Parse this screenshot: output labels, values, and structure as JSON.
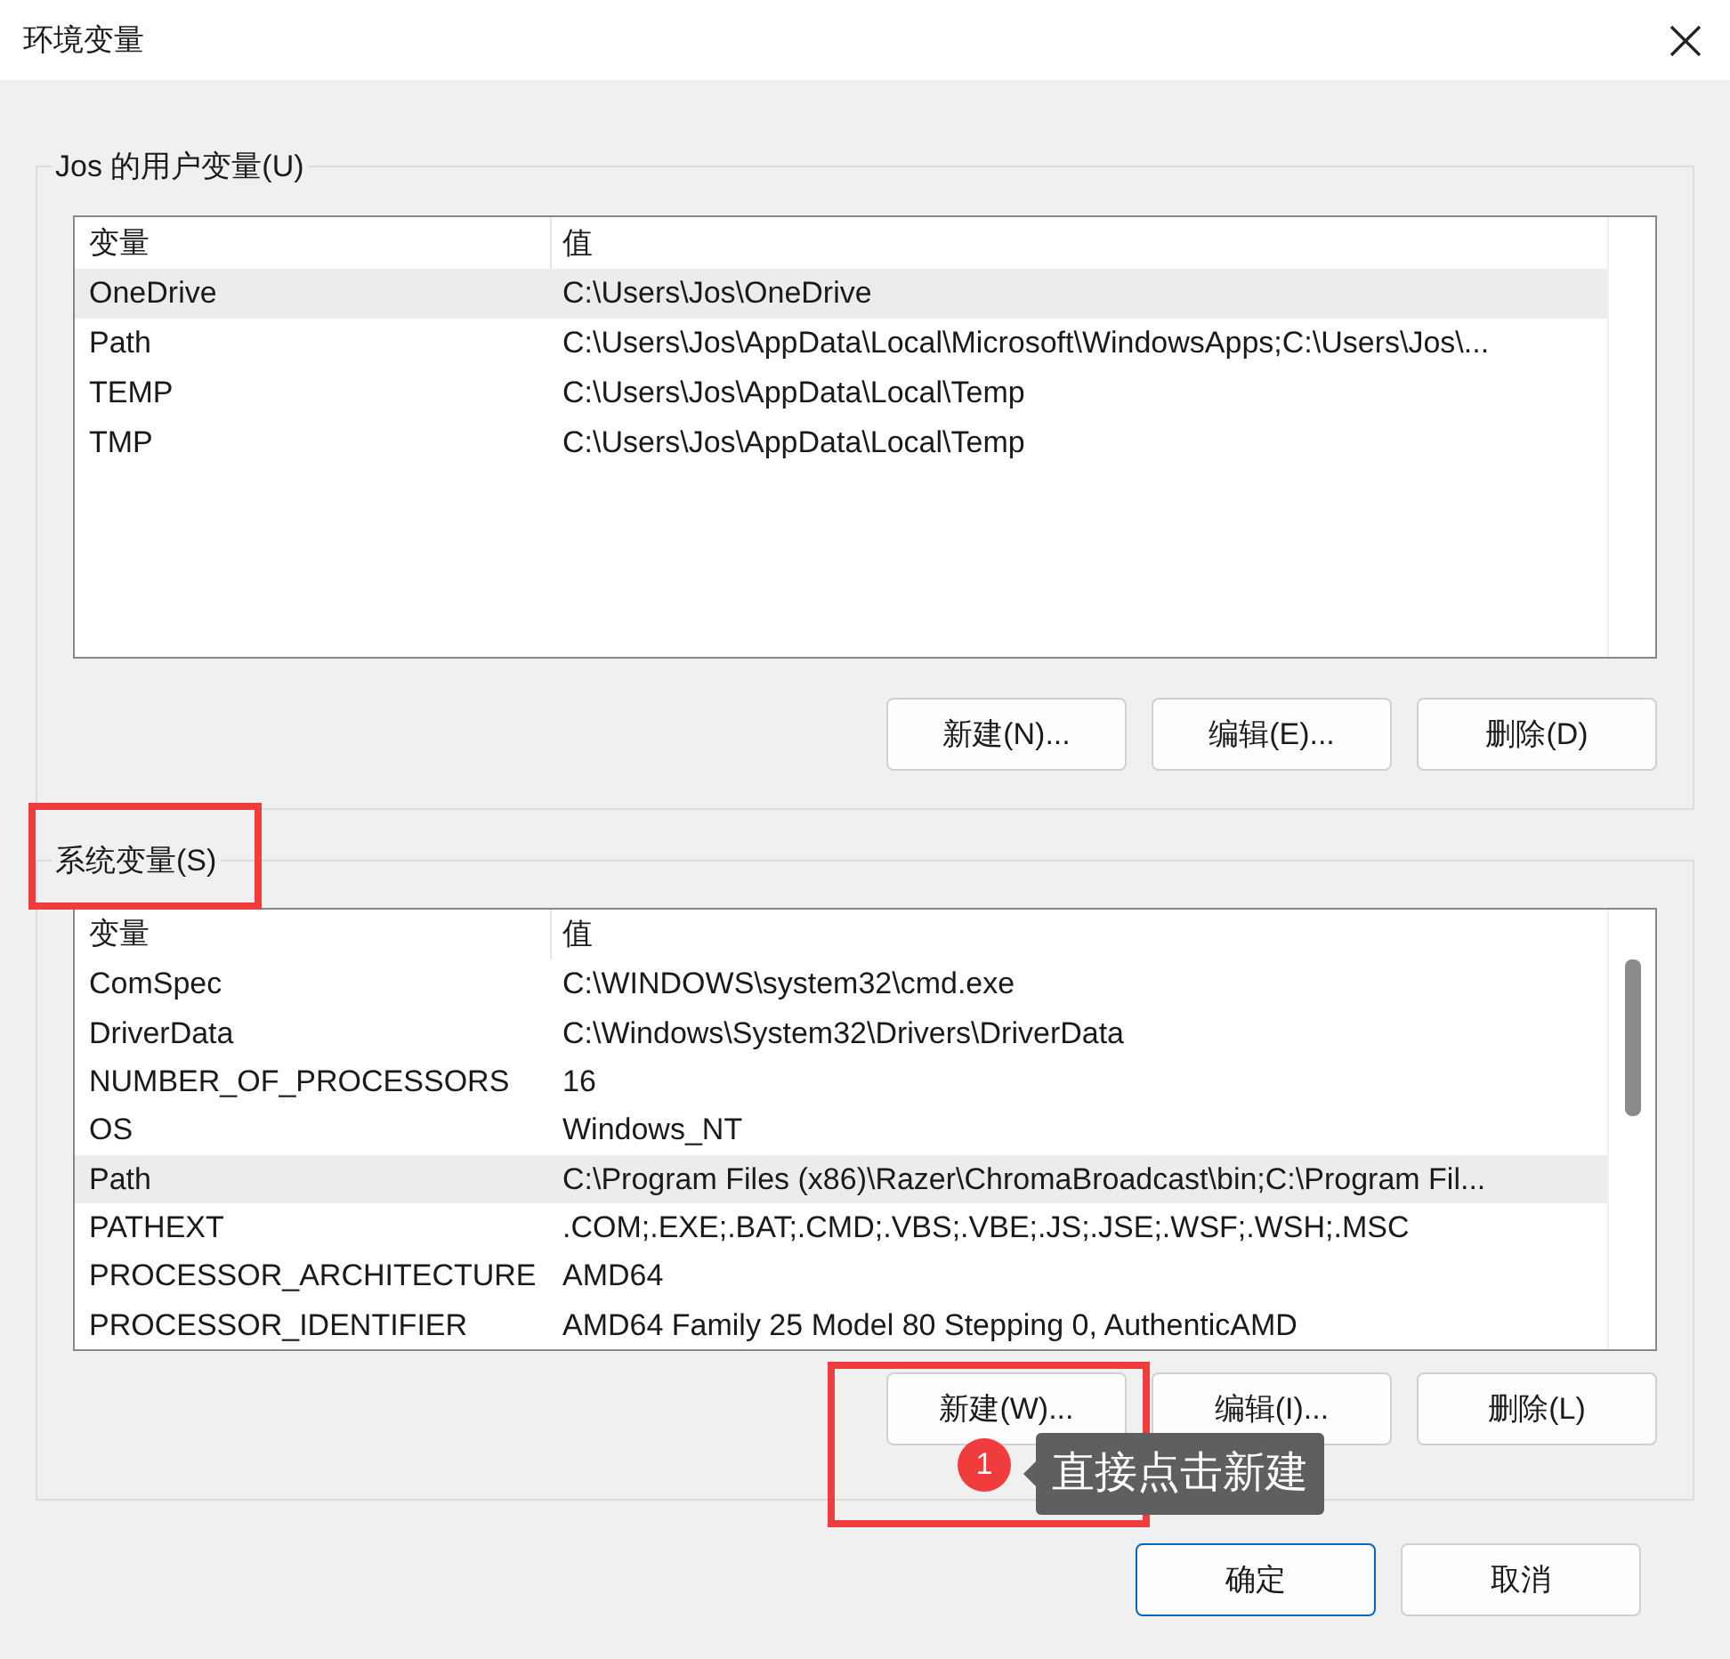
{
  "window": {
    "title": "环境变量"
  },
  "user_vars": {
    "title": "Jos 的用户变量(U)",
    "columns": [
      "变量",
      "值"
    ],
    "rows": [
      {
        "name": "OneDrive",
        "value": "C:\\Users\\Jos\\OneDrive",
        "selected": true
      },
      {
        "name": "Path",
        "value": "C:\\Users\\Jos\\AppData\\Local\\Microsoft\\WindowsApps;C:\\Users\\Jos\\...",
        "selected": false
      },
      {
        "name": "TEMP",
        "value": "C:\\Users\\Jos\\AppData\\Local\\Temp",
        "selected": false
      },
      {
        "name": "TMP",
        "value": "C:\\Users\\Jos\\AppData\\Local\\Temp",
        "selected": false
      }
    ],
    "buttons": [
      "新建(N)...",
      "编辑(E)...",
      "删除(D)"
    ]
  },
  "system_vars": {
    "title": "系统变量(S)",
    "columns": [
      "变量",
      "值"
    ],
    "rows": [
      {
        "name": "ComSpec",
        "value": "C:\\WINDOWS\\system32\\cmd.exe",
        "selected": false
      },
      {
        "name": "DriverData",
        "value": "C:\\Windows\\System32\\Drivers\\DriverData",
        "selected": false
      },
      {
        "name": "NUMBER_OF_PROCESSORS",
        "value": "16",
        "selected": false
      },
      {
        "name": "OS",
        "value": "Windows_NT",
        "selected": false
      },
      {
        "name": "Path",
        "value": "C:\\Program Files (x86)\\Razer\\ChromaBroadcast\\bin;C:\\Program Fil...",
        "selected": true
      },
      {
        "name": "PATHEXT",
        "value": ".COM;.EXE;.BAT;.CMD;.VBS;.VBE;.JS;.JSE;.WSF;.WSH;.MSC",
        "selected": false
      },
      {
        "name": "PROCESSOR_ARCHITECTURE",
        "value": "AMD64",
        "selected": false
      },
      {
        "name": "PROCESSOR_IDENTIFIER",
        "value": "AMD64 Family 25 Model 80 Stepping 0, AuthenticAMD",
        "selected": false
      }
    ],
    "buttons": [
      "新建(W)...",
      "编辑(I)...",
      "删除(L)"
    ]
  },
  "dialog_buttons": [
    {
      "label": "确定",
      "default": true
    },
    {
      "label": "取消",
      "default": false
    }
  ],
  "annotation": {
    "step": "1",
    "text": "直接点击新建"
  }
}
